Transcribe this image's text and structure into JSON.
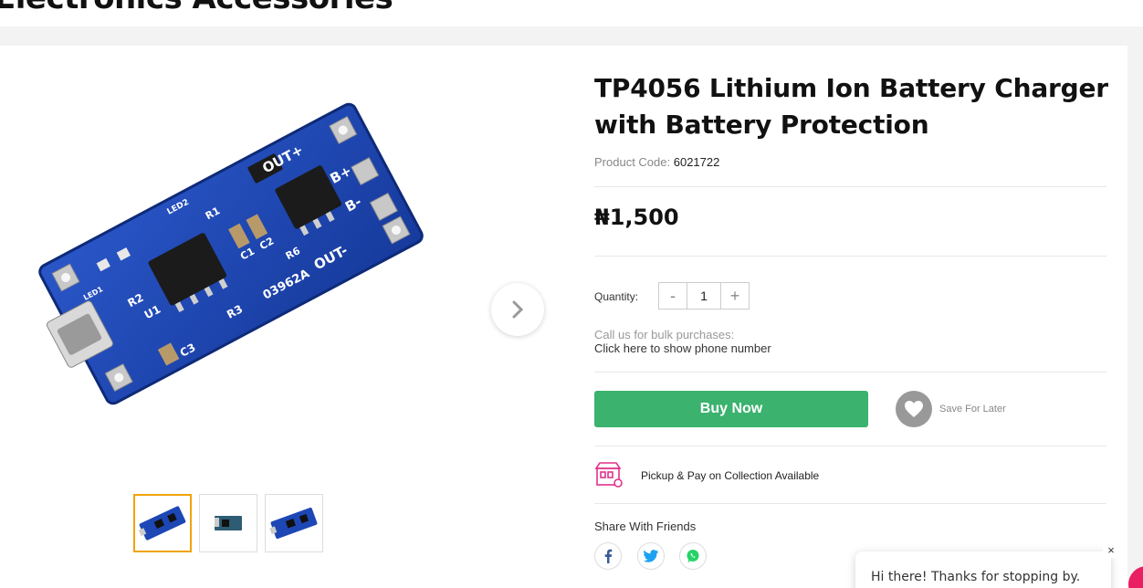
{
  "header": {
    "category_title": "Electronics Accessories"
  },
  "product": {
    "title": "TP4056 Lithium Ion Battery Charger with Battery Protection",
    "code_label": "Product Code:",
    "code_value": "6021722",
    "price": "₦1,500",
    "quantity_label": "Quantity:",
    "quantity_value": "1",
    "decrement_label": "-",
    "increment_label": "+",
    "bulk_note": "Call us for bulk purchases:",
    "bulk_link": "Click here to show phone number",
    "buy_label": "Buy Now",
    "save_label": "Save For Later",
    "pickup_text": "Pickup & Pay on Collection Available",
    "share_label": "Share With Friends"
  },
  "board_silkscreen": {
    "out_plus": "OUT+",
    "b_plus": "B+",
    "b_minus": "B-",
    "out_minus": "OUT-",
    "code": "03962A",
    "r1": "R1",
    "r2": "R2",
    "r3": "R3",
    "u1": "U1",
    "c1": "C1",
    "c2": "C2",
    "c3": "C3",
    "r6": "R6",
    "led1": "LED1",
    "led2": "LED2"
  },
  "chat": {
    "greeting": "Hi there! Thanks for stopping by.",
    "close": "×"
  },
  "icons": {
    "next": "chevron-right-icon",
    "heart": "heart-icon",
    "pickup": "store-icon",
    "facebook": "facebook-icon",
    "twitter": "twitter-icon",
    "whatsapp": "whatsapp-icon"
  },
  "colors": {
    "buy_button": "#3bb26e",
    "active_thumb_border": "#f0a30a",
    "pickup_icon": "#e0318a",
    "facebook": "#3b5998",
    "twitter": "#1da1f2",
    "whatsapp": "#25d366",
    "chat_bubble": "#e91e63"
  }
}
